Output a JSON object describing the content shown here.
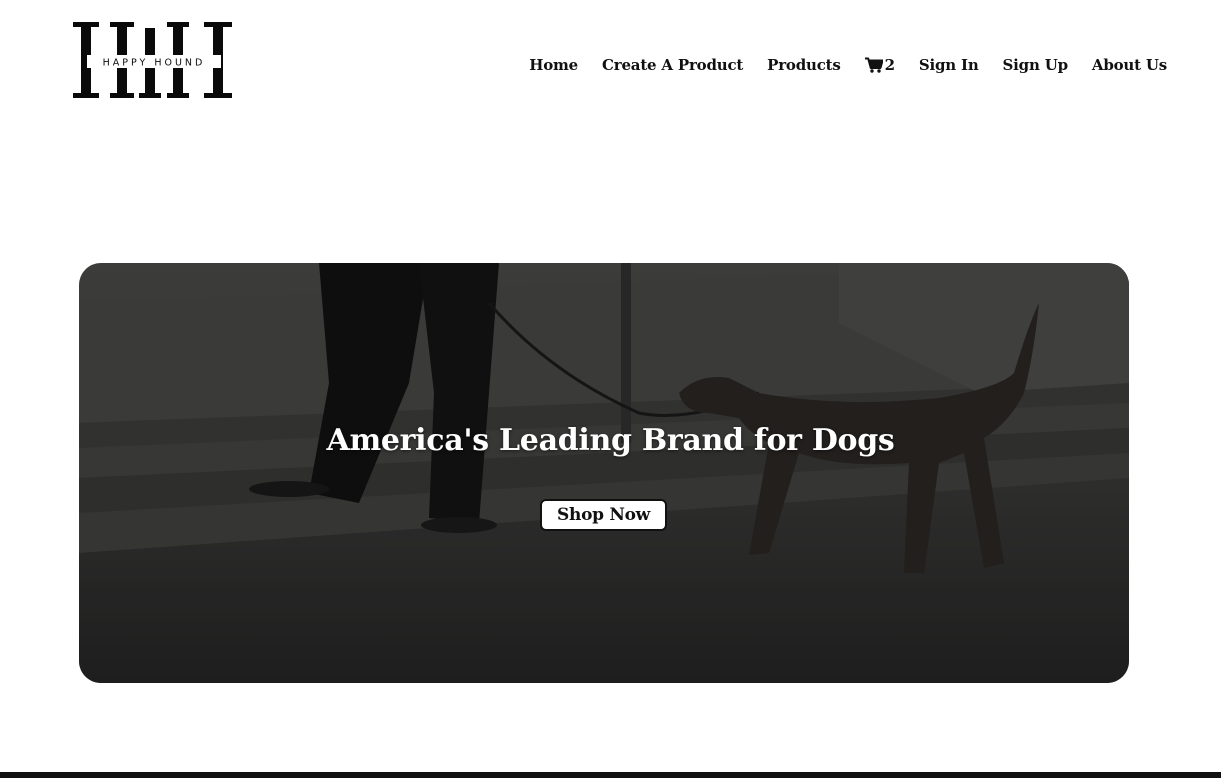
{
  "logo": {
    "text": "HAPPY HOUND",
    "colors": {
      "ink": "#0a0a0a"
    }
  },
  "nav": {
    "items": [
      {
        "label": "Home"
      },
      {
        "label": "Create A Product"
      },
      {
        "label": "Products"
      },
      {
        "label": "Sign In"
      },
      {
        "label": "Sign Up"
      },
      {
        "label": "About Us"
      }
    ],
    "cart": {
      "icon": "cart-icon",
      "count": "2"
    }
  },
  "hero": {
    "title": "America's Leading Brand for Dogs",
    "cta_label": "Shop Now",
    "image": "person-walking-dog-on-steps"
  },
  "colors": {
    "text": "#111111",
    "background": "#ffffff",
    "hero_overlay": "#2c2c2c",
    "footer_bar": "#111111"
  }
}
